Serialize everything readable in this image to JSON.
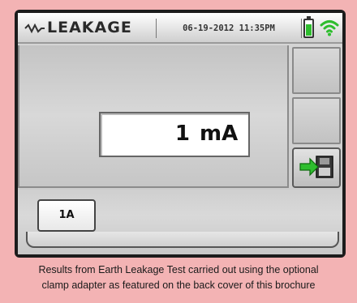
{
  "header": {
    "mode_icon": "leakage-mode-icon",
    "title": "LEAKAGE",
    "datetime": "06-19-2012 11:35PM",
    "battery_icon": "battery-icon",
    "battery_level": 0.8,
    "wifi_icon": "wifi-icon"
  },
  "reading": {
    "value": "1",
    "unit": "mA"
  },
  "side_buttons": {
    "save_icon": "save-to-memory-icon"
  },
  "range_button": {
    "label": "1A"
  },
  "caption": {
    "line1": "Results from Earth Leakage Test carried out using the optional",
    "line2": "clamp adapter as featured on the back cover of this brochure"
  },
  "colors": {
    "page_background": "#f3b3b4",
    "accent_green": "#2ebd2e"
  }
}
